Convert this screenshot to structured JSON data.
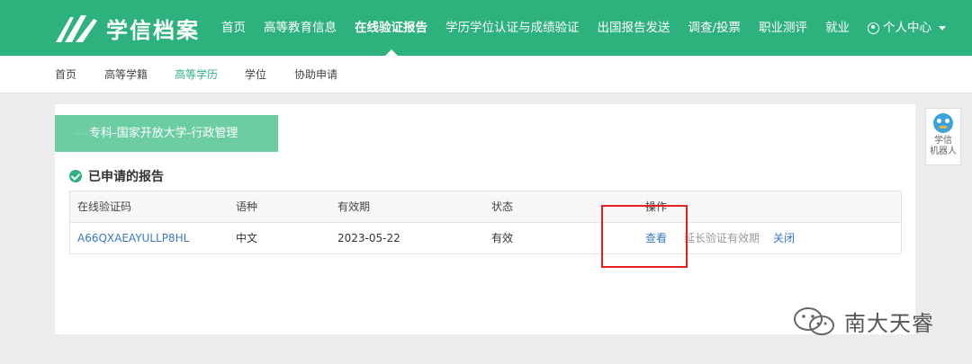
{
  "brand": {
    "name": "学信档案",
    "accent": "#2eb27d"
  },
  "nav": {
    "items": [
      "首页",
      "高等教育信息",
      "在线验证报告",
      "学历学位认证与成绩验证",
      "出国报告发送",
      "调查/投票",
      "职业测评",
      "就业"
    ],
    "active_index": 2,
    "user_label": "个人中心"
  },
  "subnav": {
    "items": [
      "首页",
      "高等学籍",
      "高等学历",
      "学位",
      "协助申请"
    ],
    "active_index": 2
  },
  "record_tag": "专科-国家开放大学-行政管理",
  "section_title": "已申请的报告",
  "table": {
    "headers": [
      "在线验证码",
      "语种",
      "有效期",
      "状态",
      "操作"
    ],
    "row": {
      "code": "A66QXAEAYULLP8HL",
      "language": "中文",
      "valid_until": "2023-05-22",
      "status": "有效",
      "actions": {
        "view": "查看",
        "extend": "延长验证有效期",
        "close": "关闭"
      }
    }
  },
  "robot": {
    "line1": "学信",
    "line2": "机器人"
  },
  "watermark": "南大天睿"
}
